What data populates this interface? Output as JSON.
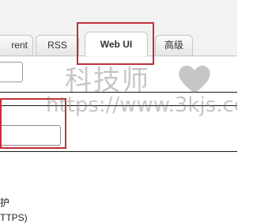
{
  "tabs": [
    {
      "label": "rent",
      "active": false
    },
    {
      "label": "RSS",
      "active": false
    },
    {
      "label": "Web UI",
      "active": true
    },
    {
      "label": "高级",
      "active": false
    }
  ],
  "fields": {
    "top_input_value": "",
    "main_input_value": ""
  },
  "section_text": {
    "line_1": "护",
    "line_2": "TTPS)"
  },
  "watermark": {
    "title": "科技师",
    "url": "https://www.3kjs.com",
    "heart_icon": "heart-icon"
  },
  "colors": {
    "highlight": "#c0303a",
    "watermark": "#787878"
  }
}
